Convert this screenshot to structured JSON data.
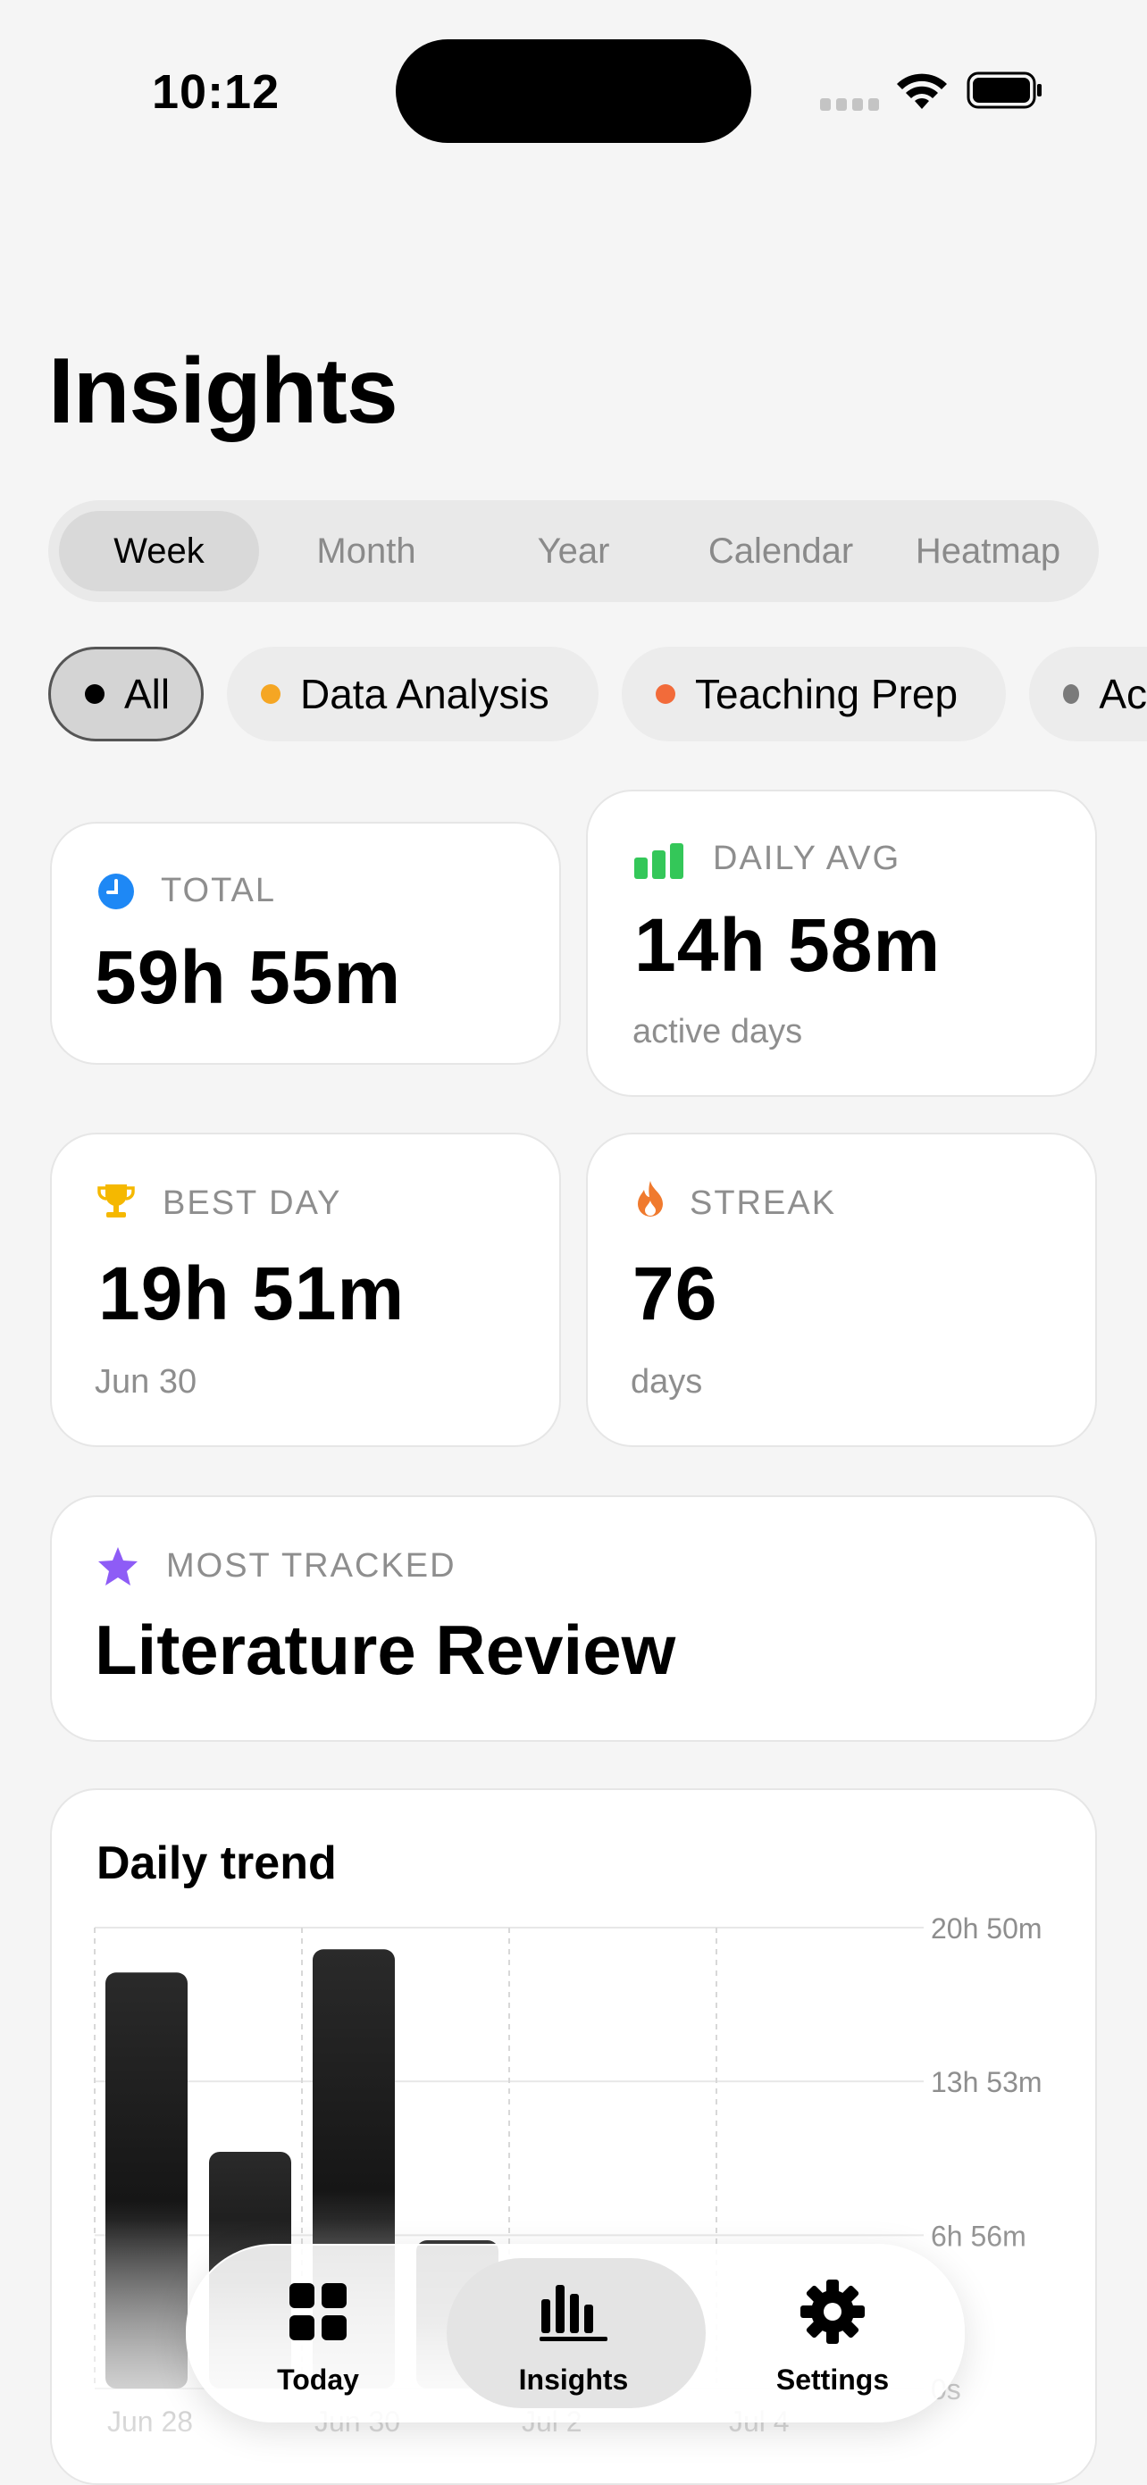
{
  "status_bar": {
    "time": "10:12"
  },
  "page_title": "Insights",
  "segments": [
    {
      "label": "Week",
      "active": true
    },
    {
      "label": "Month",
      "active": false
    },
    {
      "label": "Year",
      "active": false
    },
    {
      "label": "Calendar",
      "active": false
    },
    {
      "label": "Heatmap",
      "active": false
    }
  ],
  "filters": [
    {
      "label": "All",
      "color": "#000000",
      "active": true
    },
    {
      "label": "Data Analysis",
      "color": "#F5A623",
      "active": false
    },
    {
      "label": "Teaching Prep",
      "color": "#F26B3A",
      "active": false
    },
    {
      "label": "Ac",
      "color": "#7A7A7A",
      "active": false
    }
  ],
  "stats": {
    "total": {
      "label": "TOTAL",
      "value": "59h 55m",
      "icon": "clock-icon",
      "color": "#1E88F5"
    },
    "daily_avg": {
      "label": "DAILY AVG",
      "value": "14h 58m",
      "sub": "active days",
      "icon": "bar-chart-icon",
      "color": "#34C759"
    },
    "best_day": {
      "label": "BEST DAY",
      "value": "19h 51m",
      "sub": "Jun 30",
      "icon": "trophy-icon",
      "color": "#F5B800"
    },
    "streak": {
      "label": "STREAK",
      "value": "76",
      "sub": "days",
      "icon": "flame-icon",
      "color": "#F07A2E"
    }
  },
  "most_tracked": {
    "label": "MOST TRACKED",
    "value": "Literature Review",
    "icon": "star-icon",
    "color": "#8E5CF6"
  },
  "chart_data": {
    "type": "bar",
    "title": "Daily trend",
    "categories": [
      "Jun 28",
      "Jun 29",
      "Jun 30",
      "Jul 1",
      "Jul 2",
      "Jul 3",
      "Jul 4",
      "Jul 5"
    ],
    "tick_labels_shown": [
      "Jun 28",
      "Jun 30",
      "Jul 2",
      "Jul 4"
    ],
    "values_hours": [
      18.8,
      10.7,
      19.85,
      6.7,
      0,
      0,
      0,
      0
    ],
    "y_ticks": [
      "20h 50m",
      "13h 53m",
      "6h 56m",
      "0s"
    ],
    "y_tick_values_hours": [
      20.83,
      13.88,
      6.93,
      0
    ],
    "ylim": [
      0,
      20.83
    ],
    "grid": true
  },
  "tabbar": [
    {
      "label": "Today",
      "icon": "grid-icon",
      "active": false
    },
    {
      "label": "Insights",
      "icon": "bar-chart-icon",
      "active": true
    },
    {
      "label": "Settings",
      "icon": "gear-icon",
      "active": false
    }
  ]
}
